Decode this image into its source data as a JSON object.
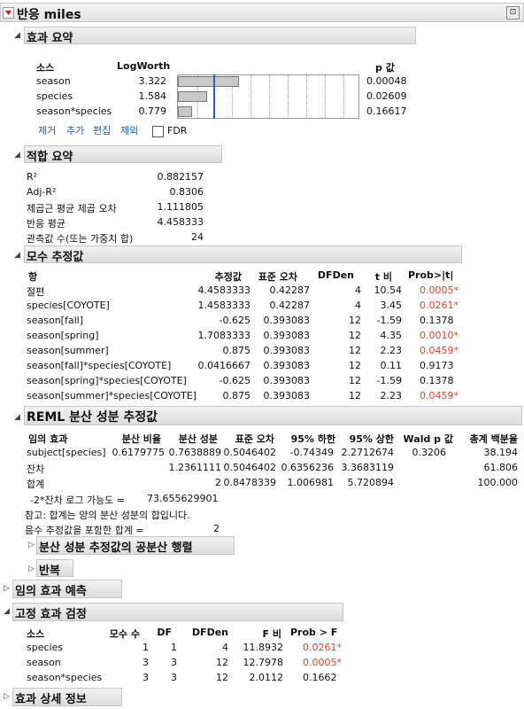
{
  "root": {
    "title": "반응 miles"
  },
  "effect_summary": {
    "title": "효과 요약",
    "col_source": "소스",
    "col_logworth": "LogWorth",
    "col_p": "p 값",
    "rows": [
      {
        "source": "season",
        "logworth": "3.322",
        "p": "0.00048",
        "logworth_value": 3.322
      },
      {
        "source": "species",
        "logworth": "1.584",
        "p": "0.02609",
        "logworth_value": 1.584
      },
      {
        "source": "season*species",
        "logworth": "0.779",
        "p": "0.16617",
        "logworth_value": 0.779
      }
    ],
    "links": {
      "remove": "제거",
      "add": "추가",
      "edit": "편집",
      "exclude": "제외"
    },
    "fdr_label": "FDR"
  },
  "fit_summary": {
    "title": "적합 요약",
    "rows": [
      {
        "label": "R²",
        "value": "0.882157"
      },
      {
        "label": "Adj-R²",
        "value": "0.8306"
      },
      {
        "label": "제곱근 평균 제곱 오차",
        "value": "1.111805"
      },
      {
        "label": "반응 평균",
        "value": "4.458333"
      },
      {
        "label": "관측값 수(또는 가중치 합)",
        "value": "24"
      }
    ]
  },
  "param_estimates": {
    "title": "모수 추정값",
    "headers": {
      "term": "항",
      "est": "추정값",
      "se": "표준 오차",
      "df": "DFDen",
      "t": "t 비",
      "p": "Prob>|t|"
    },
    "rows": [
      {
        "term": "절편",
        "est": "4.4583333",
        "se": "0.42287",
        "df": "4",
        "t": "10.54",
        "p": "0.0005*",
        "sig": true
      },
      {
        "term": "species[COYOTE]",
        "est": "1.4583333",
        "se": "0.42287",
        "df": "4",
        "t": "3.45",
        "p": "0.0261*",
        "sig": true
      },
      {
        "term": "season[fall]",
        "est": "-0.625",
        "se": "0.393083",
        "df": "12",
        "t": "-1.59",
        "p": "0.1378",
        "sig": false
      },
      {
        "term": "season[spring]",
        "est": "1.7083333",
        "se": "0.393083",
        "df": "12",
        "t": "4.35",
        "p": "0.0010*",
        "sig": true
      },
      {
        "term": "season[summer]",
        "est": "0.875",
        "se": "0.393083",
        "df": "12",
        "t": "2.23",
        "p": "0.0459*",
        "sig": true
      },
      {
        "term": "season[fall]*species[COYOTE]",
        "est": "0.0416667",
        "se": "0.393083",
        "df": "12",
        "t": "0.11",
        "p": "0.9173",
        "sig": false
      },
      {
        "term": "season[spring]*species[COYOTE]",
        "est": "-0.625",
        "se": "0.393083",
        "df": "12",
        "t": "-1.59",
        "p": "0.1378",
        "sig": false
      },
      {
        "term": "season[summer]*species[COYOTE]",
        "est": "0.875",
        "se": "0.393083",
        "df": "12",
        "t": "2.23",
        "p": "0.0459*",
        "sig": true
      }
    ]
  },
  "reml": {
    "title": "REML 분산 성분 추정값",
    "headers": {
      "effect": "임의 효과",
      "ratio": "분산 비율",
      "comp": "분산 성분",
      "se": "표준 오차",
      "lo": "95% 하한",
      "hi": "95% 상한",
      "wald": "Wald p 값",
      "pct": "총계 백분율"
    },
    "rows": [
      {
        "effect": "subject[species]",
        "ratio": "0.6179775",
        "comp": "0.7638889",
        "se": "0.5046402",
        "lo": "-0.74349",
        "hi": "2.2712674",
        "wald": "0.3206",
        "pct": "38.194"
      },
      {
        "effect": "잔차",
        "ratio": "",
        "comp": "1.2361111",
        "se": "0.5046402",
        "lo": "0.6356236",
        "hi": "3.3683119",
        "wald": "",
        "pct": "61.806"
      },
      {
        "effect": "합계",
        "ratio": "",
        "comp": "2",
        "se": "0.8478339",
        "lo": "1.006981",
        "hi": "5.720894",
        "wald": "",
        "pct": "100.000"
      }
    ],
    "loglik_label": "-2*잔차 로그 가능도 =",
    "loglik_value": "73.655629901",
    "note": "참고: 합계는 양의 분산 성분의 합입니다.",
    "neg_label": "음수 추정값을 포함한 합계 =",
    "neg_value": "2",
    "cov_title": "분산 성분 추정값의 공분산 행렬",
    "iter_title": "반복"
  },
  "random_pred": {
    "title": "임의 효과 예측"
  },
  "fixed_tests": {
    "title": "고정 효과 검정",
    "headers": {
      "source": "소스",
      "nparm": "모수 수",
      "df": "DF",
      "dfden": "DFDen",
      "f": "F 비",
      "p": "Prob > F"
    },
    "rows": [
      {
        "source": "species",
        "nparm": "1",
        "df": "1",
        "dfden": "4",
        "f": "11.8932",
        "p": "0.0261*"
      },
      {
        "source": "season",
        "nparm": "3",
        "df": "3",
        "dfden": "12",
        "f": "12.7978",
        "p": "0.0005*"
      },
      {
        "source": "season*species",
        "nparm": "3",
        "df": "3",
        "dfden": "12",
        "f": "2.0112",
        "p": "0.1662"
      }
    ]
  },
  "effect_details": {
    "title": "효과 상세 정보"
  },
  "colors": {
    "sig_red": "#e0442b",
    "link_blue": "#1a5fb4",
    "ref_line": "#2b5fd0"
  }
}
